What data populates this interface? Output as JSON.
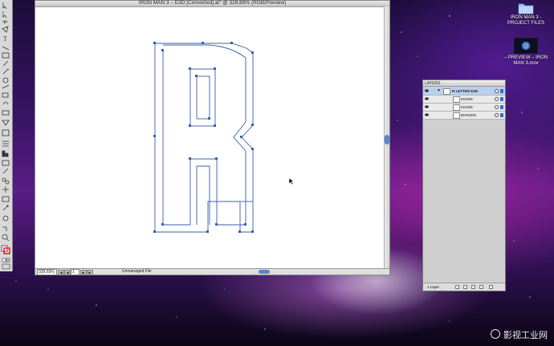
{
  "document": {
    "title": "IRON MAN 3 – E3D [Converted].ai* @ 328,69% (RGB/Preview)",
    "zoom": "328,69%",
    "page": "1",
    "status": "Unmanaged File"
  },
  "layers_panel": {
    "tab_label": "LAYERS",
    "items": [
      {
        "label": "R LETTER E3D",
        "selected": true
      },
      {
        "label": "INSIDE",
        "selected": false
      },
      {
        "label": "INSIDE",
        "selected": false
      },
      {
        "label": "BORDER",
        "selected": false
      }
    ],
    "footer_count": "1 Layer"
  },
  "desktop": {
    "folder_label_line1": "IRON MAN 3 -",
    "folder_label_line2": "PROJECT FILES",
    "movie_label_line1": "– PREVIEW – IRON",
    "movie_label_line2": "MAN 3.mov"
  },
  "watermark": "影视工业网",
  "colors": {
    "path": "#3a5fae",
    "selection": "#b9cfee",
    "accent": "#5d86c9"
  }
}
